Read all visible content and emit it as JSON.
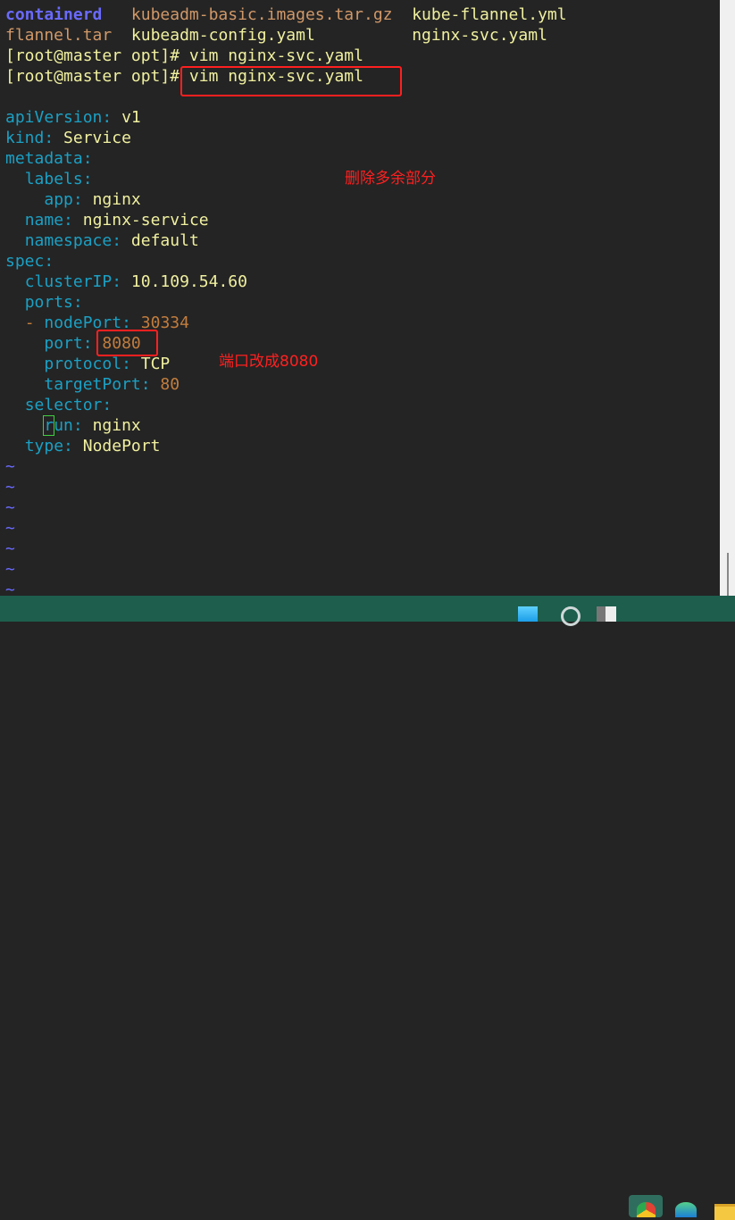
{
  "ls_output": {
    "row1": [
      "containerd",
      "kubeadm-basic.images.tar.gz",
      "kube-flannel.yml"
    ],
    "row2": [
      "flannel.tar",
      "kubeadm-config.yaml",
      "nginx-svc.yaml"
    ]
  },
  "prompts": [
    {
      "prompt": "[root@master opt]#",
      "command": " vim nginx-svc.yaml"
    },
    {
      "prompt": "[root@master opt]#",
      "command": " vim nginx-svc.yaml"
    }
  ],
  "yaml": {
    "apiVersion": "v1",
    "kind": "Service",
    "metadata_key": "metadata",
    "labels_key": "labels",
    "app": "nginx",
    "name": "nginx-service",
    "namespace": "default",
    "spec_key": "spec",
    "clusterIP": "10.109.54.60",
    "ports_key": "ports",
    "nodePort": "30334",
    "port": "8080",
    "protocol": "TCP",
    "targetPort": "80",
    "selector_key": "selector",
    "run_cursor": "r",
    "run_rest": "un",
    "run": "nginx",
    "type": "NodePort"
  },
  "tilde": "~",
  "annotations": {
    "delete_note": "删除多余部分",
    "port_note": "端口改成8080"
  },
  "taskbar": [
    "windows-start",
    "search",
    "task-view",
    "chrome",
    "edge",
    "file-explorer"
  ]
}
